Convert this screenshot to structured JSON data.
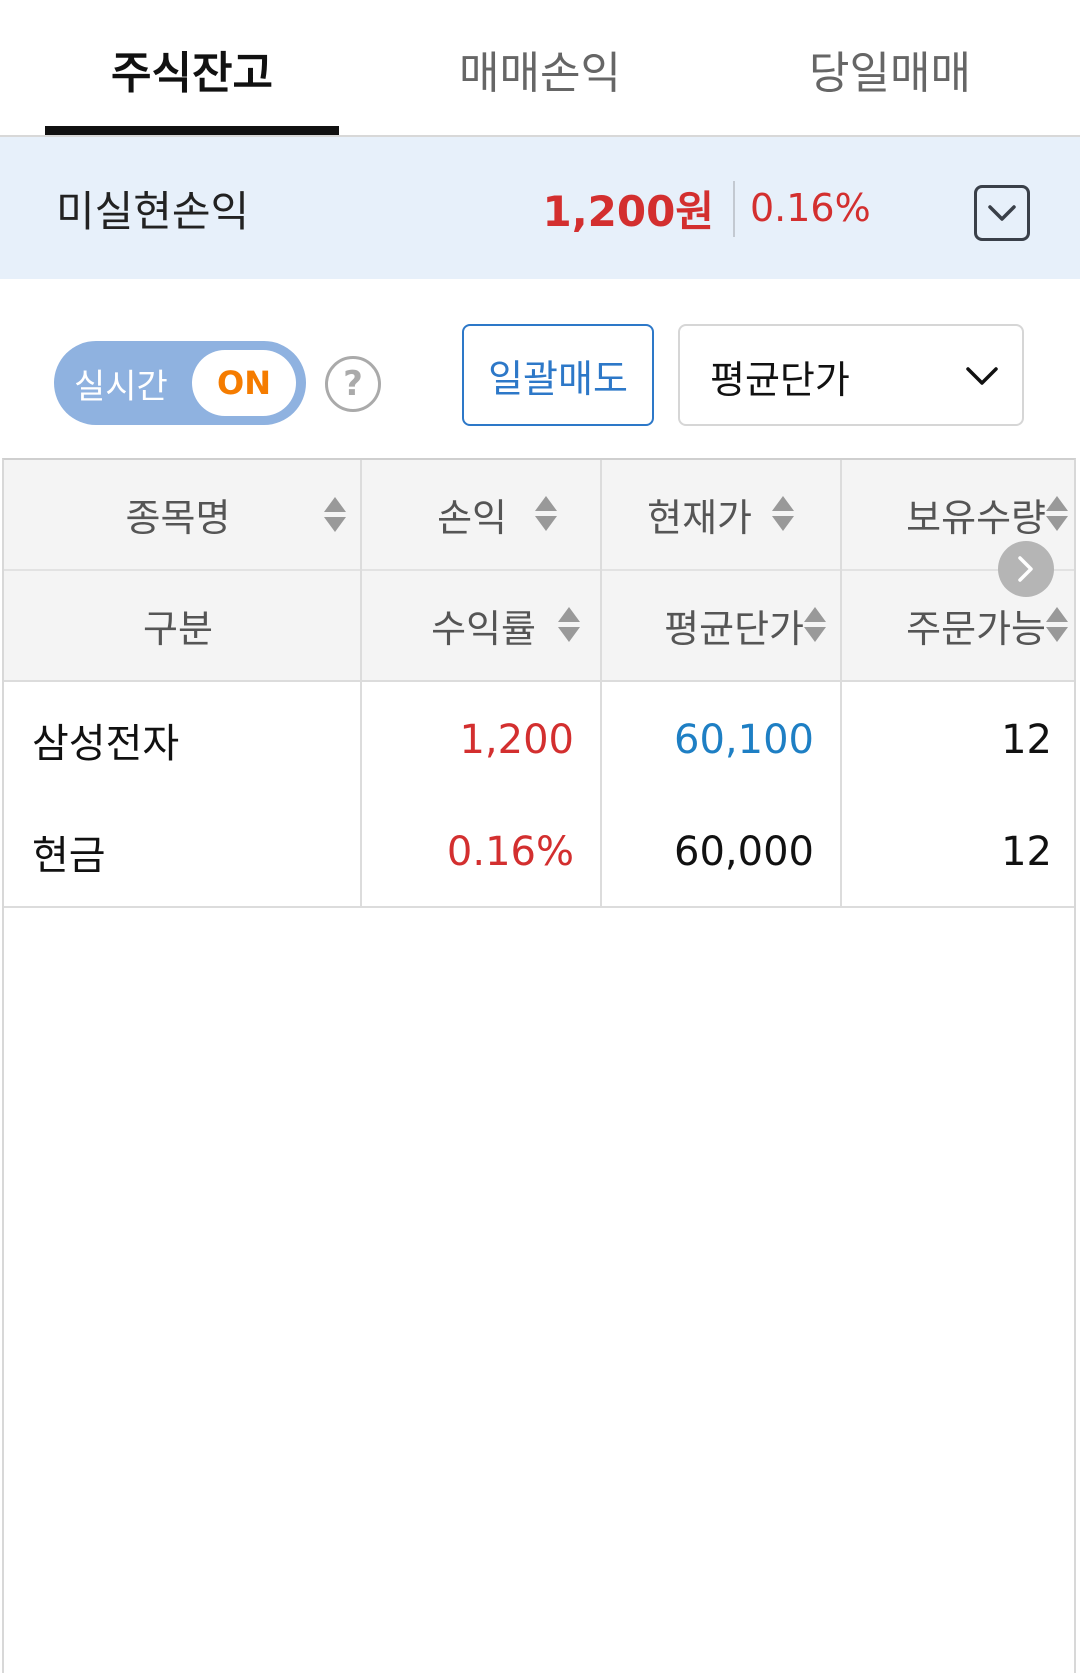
{
  "tabs": [
    {
      "label": "주식잔고",
      "active": true
    },
    {
      "label": "매매손익",
      "active": false
    },
    {
      "label": "당일매매",
      "active": false
    }
  ],
  "summary": {
    "label": "미실현손익",
    "amount": "1,200원",
    "rate": "0.16%"
  },
  "controls": {
    "realtime_label": "실시간",
    "realtime_state": "ON",
    "help_symbol": "?",
    "bulk_sell_label": "일괄매도",
    "sort_select_value": "평균단가"
  },
  "table": {
    "header_row1": [
      "종목명",
      "손익",
      "현재가",
      "보유수량"
    ],
    "header_row2": [
      "구분",
      "수익률",
      "평균단가",
      "주문가능"
    ],
    "rows": [
      {
        "name": "삼성전자",
        "category": "현금",
        "profit": "1,200",
        "profit_rate": "0.16%",
        "current_price": "60,100",
        "avg_price": "60,000",
        "holding_qty": "12",
        "orderable_qty": "12"
      }
    ]
  },
  "colors": {
    "profit_red": "#d32f2f",
    "price_blue": "#1e7fc4",
    "summary_bg": "#e7f0fa",
    "toggle_bg": "#8fb2e0",
    "toggle_on_text": "#f57c00",
    "bulk_sell_blue": "#2d78c8"
  }
}
